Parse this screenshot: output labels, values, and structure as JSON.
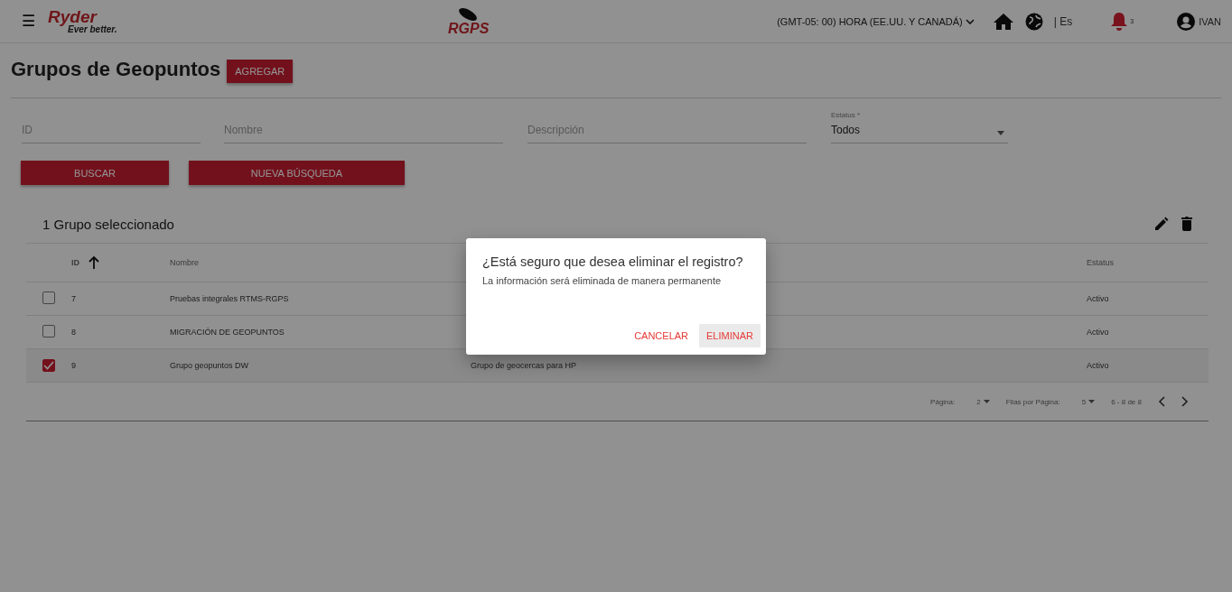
{
  "header": {
    "menu_icon": "☰",
    "brand": "Ryder",
    "brand_tagline": "Ever better.",
    "app_logo": "RGPS",
    "timezone": "(GMT-05: 00) HORA (EE.UU. Y CANADÁ)",
    "language": "| Es",
    "notifications": "3",
    "user": "IVAN"
  },
  "page": {
    "title": "Grupos de Geopuntos",
    "add_button": "AGREGAR"
  },
  "filters": {
    "fields": [
      {
        "kind": "text",
        "placeholder": "ID"
      },
      {
        "kind": "text",
        "placeholder": "Nombre"
      },
      {
        "kind": "text",
        "placeholder": "Descripción"
      },
      {
        "kind": "select",
        "label": "Estatus *",
        "value": "Todos"
      }
    ],
    "buttons": [
      "BUSCAR",
      "NUEVA BÚSQUEDA"
    ]
  },
  "table": {
    "selection_title": "1 Grupo seleccionado",
    "columns": [
      "ID",
      "Nombre",
      "Estatus"
    ],
    "rows": [
      {
        "selected": false,
        "id": "7",
        "name": "Pruebas integrales RTMS-RGPS",
        "status": "Activo"
      },
      {
        "selected": false,
        "id": "8",
        "name": "MIGRACIÓN DE GEOPUNTOS",
        "status": "Activo"
      },
      {
        "selected": true,
        "id": "9",
        "name": "Grupo geopuntos DW",
        "description": "Grupo de geocercas para HP",
        "status": "Activo"
      }
    ],
    "pagination": {
      "page_label": "Página:",
      "page": "2",
      "rows_label": "Filas por Página:",
      "rows_per_page": "5",
      "range": "6 - 8 de 8"
    }
  },
  "dialog": {
    "title": "¿Está seguro que desea eliminar el registro?",
    "message": "La información será eliminada de manera permanente",
    "buttons": [
      {
        "label": "CANCELAR",
        "selected": false
      },
      {
        "label": "ELIMINAR",
        "selected": true
      }
    ]
  }
}
